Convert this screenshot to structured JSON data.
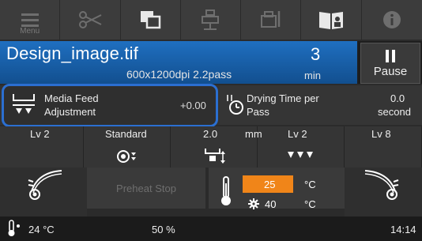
{
  "toolbar": {
    "menu_label": "Menu",
    "buttons": [
      "menu-icon",
      "scissors-icon",
      "copy-icon",
      "printhead-icon",
      "printer-settings-icon",
      "manual-icon",
      "info-icon"
    ]
  },
  "job": {
    "file_name": "Design_image.tif",
    "resolution_pass": "600x1200dpi 2.2pass",
    "remaining_value": "3",
    "remaining_unit": "min",
    "pause_label": "Pause"
  },
  "media_feed": {
    "label_line1": "Media Feed",
    "label_line2": "Adjustment",
    "value": "+0.00"
  },
  "drying": {
    "label_line1": "Drying Time per",
    "label_line2": "Pass",
    "value": "0.0",
    "unit": "second"
  },
  "row3": {
    "col1": "Lv 2",
    "col2": "Standard",
    "col3_value": "2.0",
    "col3_unit": "mm",
    "col4": "Lv 2",
    "col5": "Lv 8"
  },
  "heater": {
    "preheat_label": "Preheat Stop",
    "current_temp": "25",
    "current_unit": "°C",
    "set_temp": "40",
    "set_unit": "°C"
  },
  "status_bar": {
    "temperature": "24 °C",
    "humidity": "50 %",
    "time": "14:14"
  },
  "colors": {
    "accent_blue": "#1f6fc0",
    "highlight_border": "#2b6fd1",
    "heater_orange": "#f08519"
  }
}
